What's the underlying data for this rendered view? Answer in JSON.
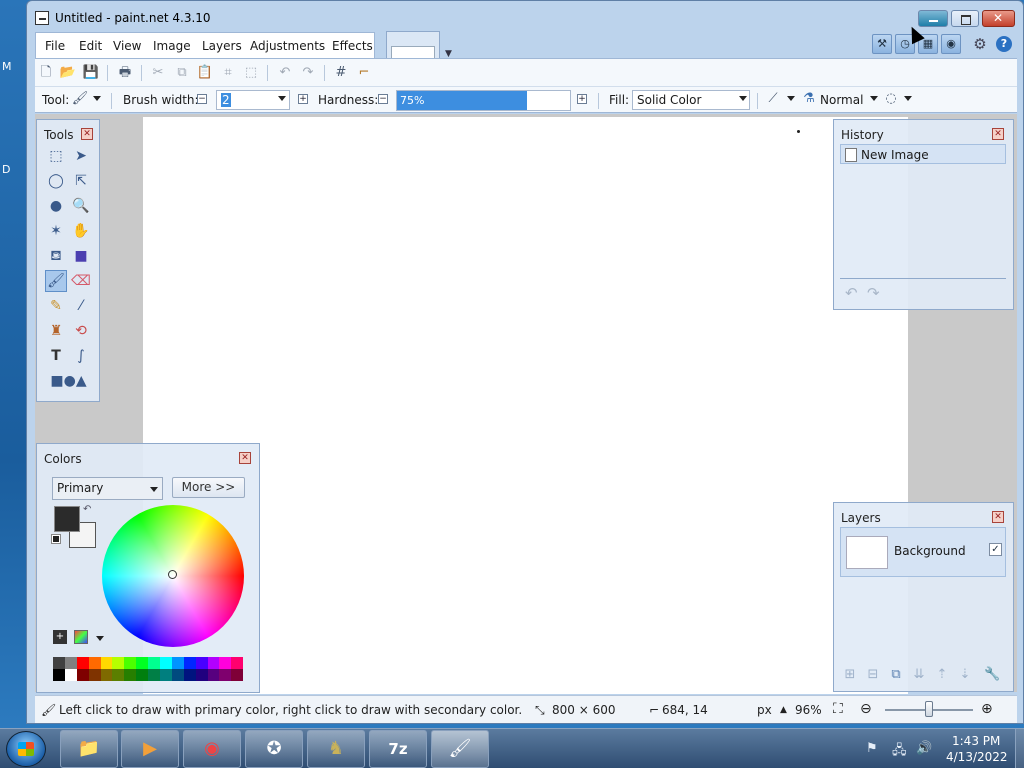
{
  "desktop": {
    "fragment_1": "M",
    "fragment_2": "D"
  },
  "window": {
    "title": "Untitled - paint.net 4.3.10",
    "menu": [
      "File",
      "Edit",
      "View",
      "Image",
      "Layers",
      "Adjustments",
      "Effects"
    ]
  },
  "tool_options": {
    "tool_label": "Tool:",
    "brush_width_label": "Brush width:",
    "brush_width_value": "2",
    "hardness_label": "Hardness:",
    "hardness_value": "75%",
    "hardness_fraction": 0.75,
    "fill_label": "Fill:",
    "fill_value": "Solid Color",
    "blend_mode": "Normal"
  },
  "tools_panel": {
    "title": "Tools"
  },
  "colors_panel": {
    "title": "Colors",
    "mode": "Primary",
    "more_label": "More >>",
    "primary_color": "#2b2b2b",
    "secondary_color": "#f4f4f4",
    "palette_top": [
      "#404040",
      "#808080",
      "#ff0000",
      "#ff6a00",
      "#ffd800",
      "#b6ff00",
      "#4cff00",
      "#00ff21",
      "#00ff90",
      "#00ffff",
      "#0094ff",
      "#0026ff",
      "#4800ff",
      "#b200ff",
      "#ff00dc",
      "#ff006e"
    ],
    "palette_bottom": [
      "#000000",
      "#ffffff",
      "#7f0000",
      "#7f3300",
      "#7f6a00",
      "#5b7f00",
      "#267f00",
      "#007f0e",
      "#007f46",
      "#007f7f",
      "#004a7f",
      "#00137f",
      "#21007f",
      "#57007f",
      "#7f006e",
      "#7f0037"
    ]
  },
  "history_panel": {
    "title": "History",
    "items": [
      "New Image"
    ]
  },
  "layers_panel": {
    "title": "Layers",
    "layers": [
      {
        "name": "Background",
        "visible": true
      }
    ]
  },
  "status": {
    "hint": "Left click to draw with primary color, right click to draw with secondary color.",
    "image_size": "800 × 600",
    "cursor_pos": "684, 14",
    "units": "px",
    "zoom": "96%"
  },
  "taskbar": {
    "time": "1:43 PM",
    "date": "4/13/2022"
  }
}
